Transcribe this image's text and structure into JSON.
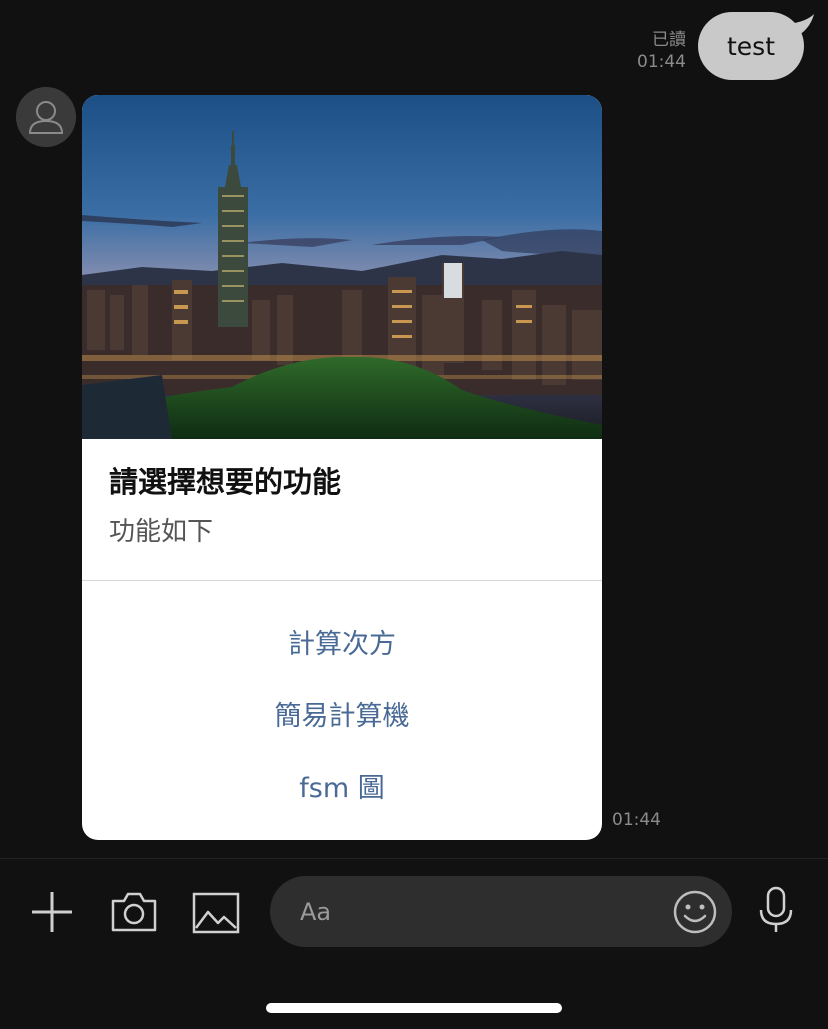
{
  "sent_message": {
    "read_label": "已讀",
    "time": "01:44",
    "text": "test"
  },
  "card": {
    "title": "請選擇想要的功能",
    "subtitle": "功能如下",
    "actions": [
      {
        "label": "計算次方"
      },
      {
        "label": "簡易計算機"
      },
      {
        "label": "fsm 圖"
      }
    ]
  },
  "received_time": "01:44",
  "input": {
    "placeholder": "Aa"
  },
  "icons": [
    "plus-icon",
    "camera-icon",
    "image-icon",
    "emoji-icon",
    "microphone-icon",
    "user-avatar-icon"
  ],
  "colors": {
    "background": "#111111",
    "sent_bubble": "#c9c9c9",
    "card_action": "#4a6a96",
    "input_bg": "#2e2e2e"
  }
}
